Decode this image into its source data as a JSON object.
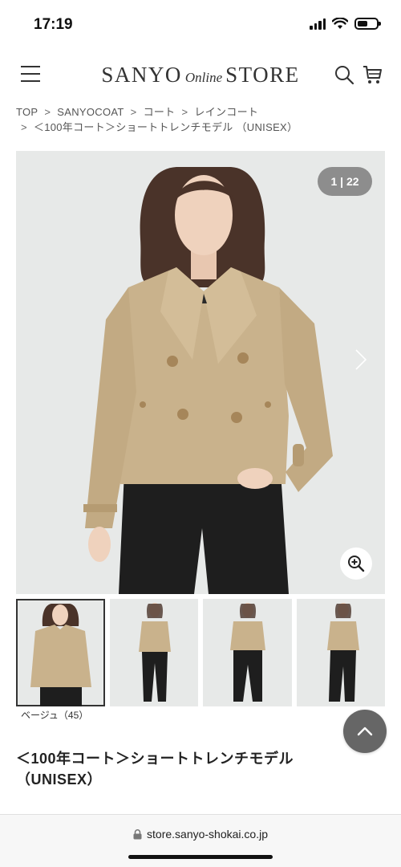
{
  "status_bar": {
    "time": "17:19",
    "battery_level": 0.55
  },
  "header": {
    "logo_left": "SANYO",
    "logo_mid": "Online",
    "logo_right": "STORE"
  },
  "breadcrumb": {
    "items": [
      "TOP",
      "SANYOCOAT",
      "コート",
      "レインコート",
      "＜100年コート＞ショートトレンチモデル （UNISEX）"
    ],
    "separator": ">"
  },
  "gallery": {
    "counter": "1 | 22",
    "color_label": "ベージュ（45）",
    "thumbnail_count": 4,
    "selected_index": 0
  },
  "product": {
    "title": "＜100年コート＞ショートトレンチモデル（UNISEX）"
  },
  "browser": {
    "url": "store.sanyo-shokai.co.jp"
  },
  "colors": {
    "coat": "#c9b28c",
    "pants": "#1e1e1e",
    "background": "#e7e9e8",
    "accent_button": "#666666"
  }
}
